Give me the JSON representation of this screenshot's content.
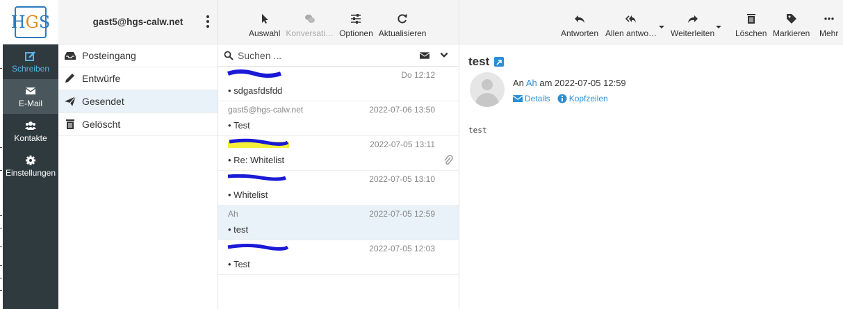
{
  "account": {
    "email": "gast5@hgs-calw.net"
  },
  "logo": {
    "text": "HGS"
  },
  "nav": {
    "compose": "Schreiben",
    "mail": "E-Mail",
    "contacts": "Kontakte",
    "settings": "Einstellungen"
  },
  "folders": [
    {
      "label": "Posteingang",
      "icon": "inbox-icon"
    },
    {
      "label": "Entwürfe",
      "icon": "pencil-icon"
    },
    {
      "label": "Gesendet",
      "icon": "paper-plane-icon",
      "active": true
    },
    {
      "label": "Gelöscht",
      "icon": "trash-icon"
    }
  ],
  "list_toolbar": {
    "select": "Auswahl",
    "threads": "Konversati…",
    "options": "Optionen",
    "refresh": "Aktualisieren"
  },
  "search": {
    "placeholder": "Suchen ..."
  },
  "messages": [
    {
      "from": "",
      "date": "Do 12:12",
      "subject": "sdgasfdsfdd",
      "redacted": true
    },
    {
      "from": "gast5@hgs-calw.net",
      "date": "2022-07-06 13:50",
      "subject": "Test"
    },
    {
      "from": "",
      "date": "2022-07-05 13:11",
      "subject": "Re: Whitelist",
      "redacted": true,
      "attachment": true
    },
    {
      "from": "",
      "date": "2022-07-05 13:10",
      "subject": "Whitelist",
      "redacted": true
    },
    {
      "from": "Ah",
      "date": "2022-07-05 12:59",
      "subject": "test",
      "selected": true
    },
    {
      "from": "",
      "date": "2022-07-05 12:03",
      "subject": "Test",
      "redacted": true
    }
  ],
  "reader_toolbar": {
    "reply": "Antworten",
    "reply_all": "Allen antwo…",
    "forward": "Weiterleiten",
    "delete": "Löschen",
    "mark": "Markieren",
    "more": "Mehr"
  },
  "reader": {
    "subject": "test",
    "to_prefix": "An",
    "to_name": "Ah",
    "date_text": "am 2022-07-05 12:59",
    "details": "Details",
    "headers": "Kopfzeilen",
    "body": "test"
  },
  "colors": {
    "accent": "#2b8fd6",
    "nav_bg": "#2f3a3f",
    "selected_bg": "#e8f2f8",
    "redaction": "#1a1ad6",
    "highlight": "#f5f03a"
  }
}
